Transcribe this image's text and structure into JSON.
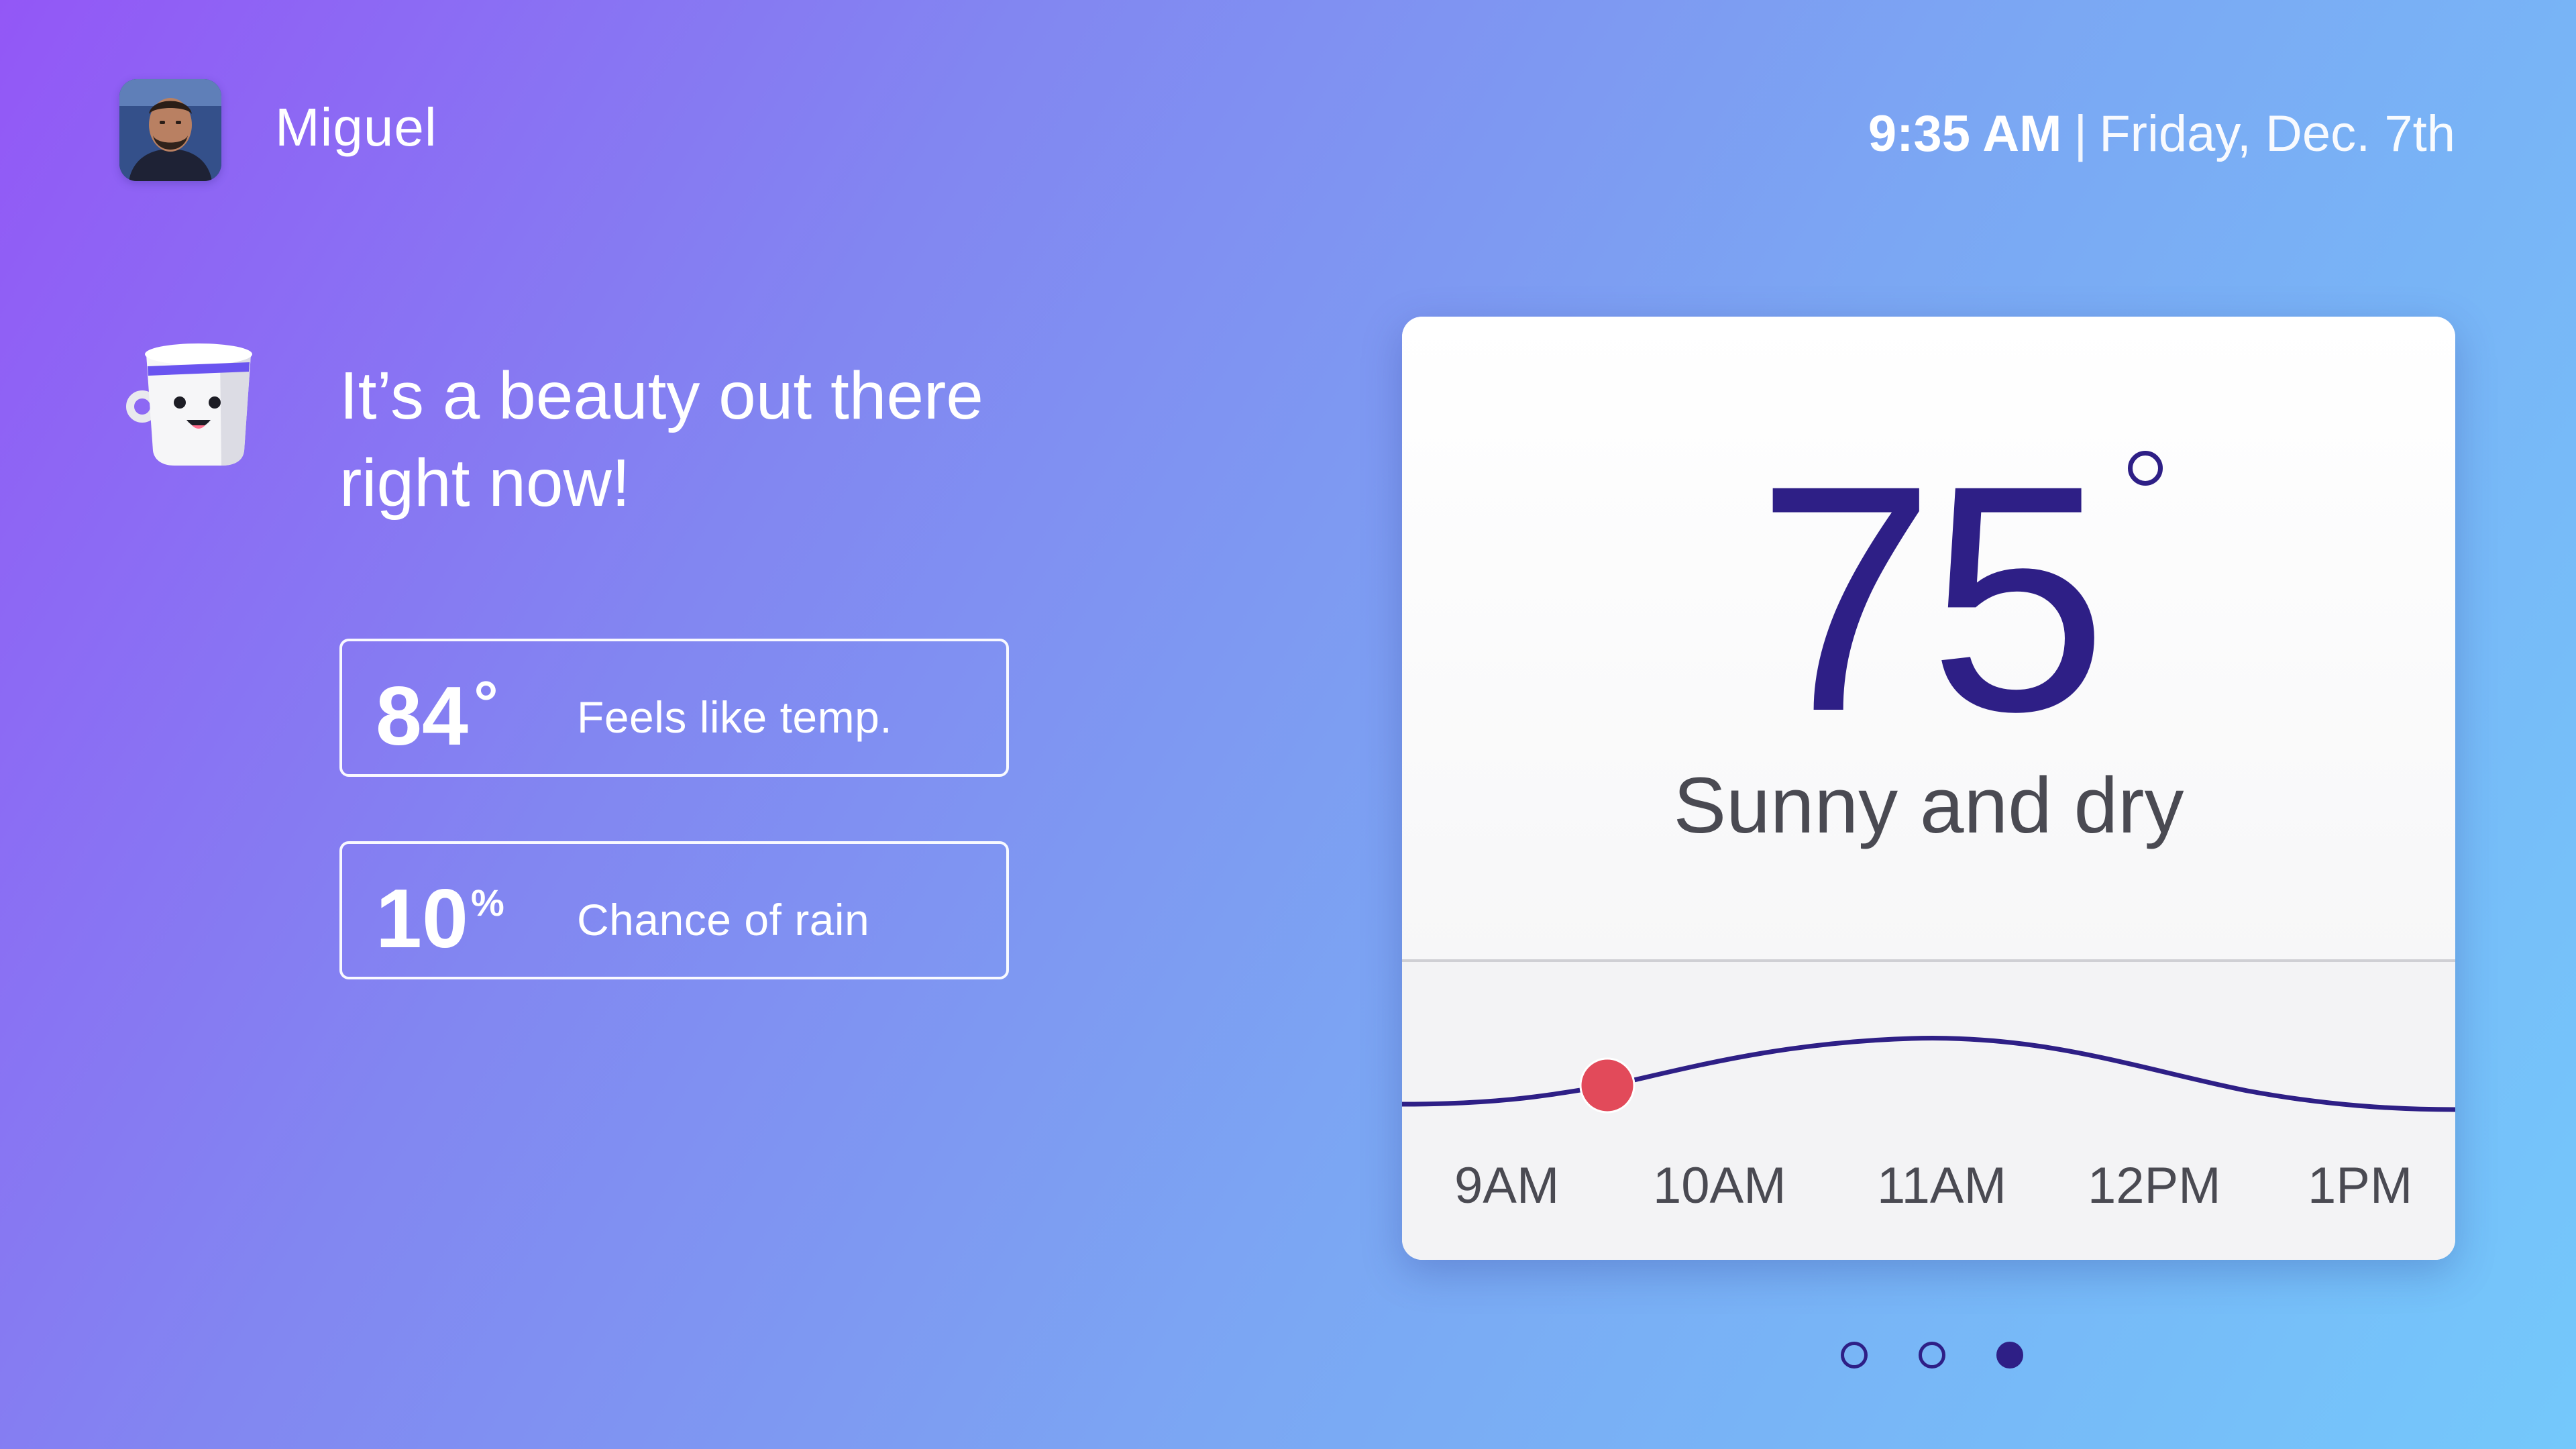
{
  "header": {
    "user_name": "Miguel",
    "time": "9:35 AM",
    "separator": "|",
    "date": "Friday, Dec. 7th"
  },
  "assistant": {
    "line1": "It’s a beauty out there",
    "line2": "right now!"
  },
  "stats": {
    "feels_like": {
      "value": "84",
      "unit": "°",
      "label": "Feels like temp."
    },
    "rain": {
      "value": "10",
      "unit": "%",
      "label": "Chance of rain"
    }
  },
  "weather": {
    "temperature": "75",
    "condition": "Sunny and dry",
    "accent_color": "#2e1f86",
    "marker_color": "#e24a5a",
    "timeline": {
      "labels": [
        "9AM",
        "10AM",
        "11AM",
        "12PM",
        "1PM"
      ],
      "current_marker": "9:35 AM"
    }
  },
  "pagination": {
    "total": 3,
    "active_index": 2
  }
}
